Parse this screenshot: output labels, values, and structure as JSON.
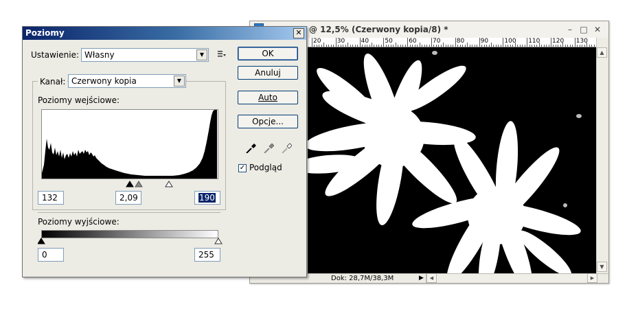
{
  "document": {
    "title": "@ 12,5% (Czerwony kopia/8) *",
    "ruler_labels": [
      "20",
      "30",
      "40",
      "50",
      "60",
      "70",
      "80",
      "90",
      "100",
      "110",
      "120",
      "130"
    ],
    "status_doc": "Dok: 28,7M/38,3M",
    "minimize_glyph": "–",
    "maximize_glyph": "□",
    "close_glyph": "✕"
  },
  "dialog": {
    "title": "Poziomy",
    "close_glyph": "✕",
    "preset_label": "Ustawienie:",
    "preset_value": "Własny",
    "channel_label": "Kanał:",
    "channel_value": "Czerwony kopia",
    "input_levels_label": "Poziomy wejściowe:",
    "input_black": "132",
    "input_gamma": "2,09",
    "input_white": "190",
    "output_levels_label": "Poziomy wyjściowe:",
    "output_black": "0",
    "output_white": "255",
    "buttons": {
      "ok": "OK",
      "cancel": "Anuluj",
      "auto": "Auto",
      "options": "Opcje..."
    },
    "preview_label": "Podgląd",
    "preview_checked": true
  },
  "icons": {
    "menu": "options-menu-icon",
    "eyedropper_black": "eyedropper-black-icon",
    "eyedropper_gray": "eyedropper-gray-icon",
    "eyedropper_white": "eyedropper-white-icon"
  }
}
